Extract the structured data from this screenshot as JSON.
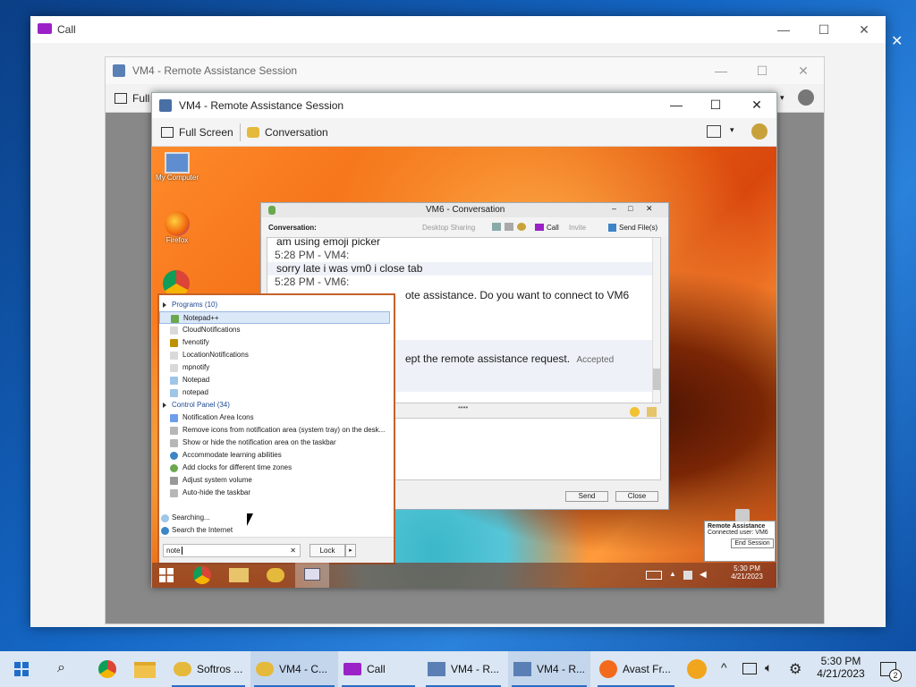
{
  "call_window": {
    "title": "Call"
  },
  "ra_outer": {
    "title": "VM4 - Remote Assistance Session",
    "toolbar_fullscreen": "Full"
  },
  "ra_inner": {
    "title": "VM4 - Remote Assistance Session",
    "toolbar": {
      "fullscreen": "Full Screen",
      "conversation": "Conversation"
    }
  },
  "desktop_icons": [
    {
      "label": "My Computer"
    },
    {
      "label": "Firefox"
    }
  ],
  "conversation": {
    "title": "VM6 - Conversation",
    "label": "Conversation:",
    "toolbar": {
      "desktop_sharing": "Desktop Sharing",
      "call": "Call",
      "invite": "Invite",
      "send_files": "Send File(s)"
    },
    "messages": [
      {
        "text": "am using emoji picker",
        "kind": "msg"
      },
      {
        "text": "5:28 PM - VM4:",
        "kind": "time"
      },
      {
        "text": "sorry late i was vm0 i close tab",
        "kind": "msg"
      },
      {
        "text": "5:28 PM - VM6:",
        "kind": "time"
      },
      {
        "text": "ote assistance. Do you want to connect to VM6",
        "kind": "partial"
      },
      {
        "text": "ept the remote assistance request.",
        "kind": "partial2",
        "extra": "Accepted"
      }
    ],
    "send_label": "Send",
    "close_label": "Close"
  },
  "start_menu": {
    "programs_header": "Programs (10)",
    "programs": [
      {
        "label": "Notepad++",
        "color": "#6aa84f"
      },
      {
        "label": "CloudNotifications",
        "color": "#d9d9d9"
      },
      {
        "label": "fvenotify",
        "color": "#bf9000"
      },
      {
        "label": "LocationNotifications",
        "color": "#d9d9d9"
      },
      {
        "label": "mpnotify",
        "color": "#d9d9d9"
      },
      {
        "label": "Notepad",
        "color": "#9fc5e8"
      },
      {
        "label": "notepad",
        "color": "#9fc5e8"
      }
    ],
    "control_header": "Control Panel (34)",
    "control": [
      {
        "label": "Notification Area Icons",
        "color": "#6d9eeb"
      },
      {
        "label": "Remove icons from notification area (system tray) on the desk...",
        "color": "#b7b7b7"
      },
      {
        "label": "Show or hide the notification area on the taskbar",
        "color": "#b7b7b7"
      },
      {
        "label": "Accommodate learning abilities",
        "color": "#3d85c6"
      },
      {
        "label": "Add clocks for different time zones",
        "color": "#6aa84f"
      },
      {
        "label": "Adjust system volume",
        "color": "#999999"
      },
      {
        "label": "Auto-hide the taskbar",
        "color": "#b7b7b7"
      }
    ],
    "searching": "Searching...",
    "search_internet": "Search the Internet",
    "search_value": "note",
    "lock_label": "Lock"
  },
  "remote_tray": {
    "time": "5:30 PM",
    "date": "4/21/2023"
  },
  "ra_notify": {
    "title": "Remote Assistance",
    "connected": "Connected user: VM6",
    "end_session": "End Session"
  },
  "host_taskbar": {
    "tasks": [
      {
        "label": "Softros ...",
        "active": false
      },
      {
        "label": "VM4 - C...",
        "active": true
      },
      {
        "label": "Call",
        "active": false
      },
      {
        "label": "VM4 - R...",
        "active": false
      },
      {
        "label": "VM4 - R...",
        "active": true
      },
      {
        "label": "Avast Fr...",
        "active": false
      }
    ],
    "time": "5:30 PM",
    "date": "4/21/2023",
    "notification_count": "2"
  }
}
